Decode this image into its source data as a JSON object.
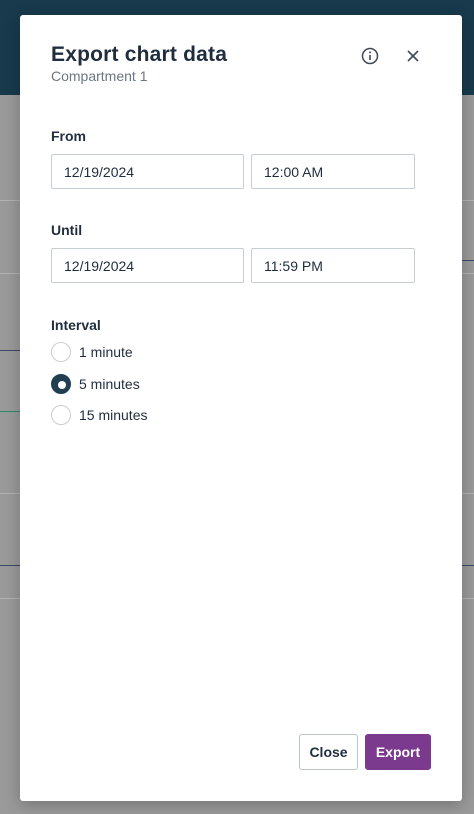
{
  "dialog": {
    "title": "Export chart data",
    "subtitle": "Compartment 1",
    "info_icon": "info-circle-icon",
    "close_icon": "close-icon"
  },
  "from": {
    "label": "From",
    "date": "12/19/2024",
    "time": "12:00 AM"
  },
  "until": {
    "label": "Until",
    "date": "12/19/2024",
    "time": "11:59 PM"
  },
  "interval": {
    "label": "Interval",
    "options": [
      {
        "label": "1 minute",
        "selected": false
      },
      {
        "label": "5 minutes",
        "selected": true
      },
      {
        "label": "15 minutes",
        "selected": false
      }
    ]
  },
  "buttons": {
    "close": "Close",
    "export": "Export"
  },
  "colors": {
    "header": "#183a4c",
    "accent": "#7b3a8e",
    "radio_checked": "#213f51"
  }
}
